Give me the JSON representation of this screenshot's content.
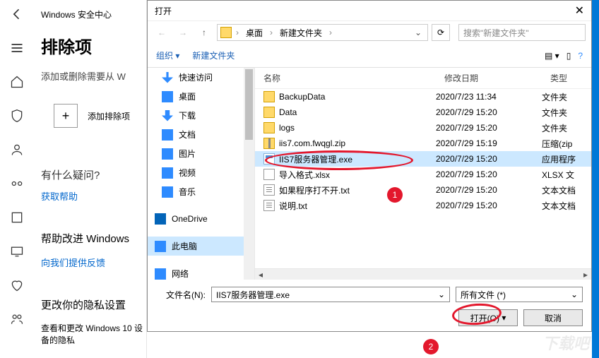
{
  "settings": {
    "window_title": "Windows 安全中心",
    "h1": "排除项",
    "sub": "添加或删除需要从 W",
    "add_label": "添加排除项",
    "question": "有什么疑问?",
    "help_link": "获取帮助",
    "improve": "帮助改进 Windows",
    "feedback_link": "向我们提供反馈",
    "privacy": "更改你的隐私设置",
    "privacy_sub": "查看和更改 Windows 10 设备的隐私"
  },
  "dialog": {
    "title": "打开",
    "close": "✕",
    "crumb_desktop": "桌面",
    "crumb_folder": "新建文件夹",
    "search_placeholder": "搜索\"新建文件夹\"",
    "organize": "组织",
    "newfolder": "新建文件夹",
    "col_name": "名称",
    "col_date": "修改日期",
    "col_type": "类型",
    "tree": [
      {
        "label": "快速访问",
        "icon": "pin"
      },
      {
        "label": "桌面",
        "icon": "desk"
      },
      {
        "label": "下载",
        "icon": "dl"
      },
      {
        "label": "文档",
        "icon": "doc"
      },
      {
        "label": "图片",
        "icon": "img"
      },
      {
        "label": "视频",
        "icon": "vid"
      },
      {
        "label": "音乐",
        "icon": "mus"
      },
      {
        "label": "OneDrive",
        "icon": "od"
      },
      {
        "label": "此电脑",
        "icon": "pc"
      },
      {
        "label": "网络",
        "icon": "net"
      }
    ],
    "files": [
      {
        "name": "BackupData",
        "date": "2020/7/23 11:34",
        "type": "文件夹",
        "icon": "folder"
      },
      {
        "name": "Data",
        "date": "2020/7/29 15:20",
        "type": "文件夹",
        "icon": "folder"
      },
      {
        "name": "logs",
        "date": "2020/7/29 15:20",
        "type": "文件夹",
        "icon": "folder"
      },
      {
        "name": "iis7.com.fwqgl.zip",
        "date": "2020/7/29 15:19",
        "type": "压缩(zip",
        "icon": "zip"
      },
      {
        "name": "IIS7服务器管理.exe",
        "date": "2020/7/29 15:20",
        "type": "应用程序",
        "icon": "exe",
        "sel": true
      },
      {
        "name": "导入格式.xlsx",
        "date": "2020/7/29 15:20",
        "type": "XLSX 文",
        "icon": "xlsx"
      },
      {
        "name": "如果程序打不开.txt",
        "date": "2020/7/29 15:20",
        "type": "文本文档",
        "icon": "txt"
      },
      {
        "name": "说明.txt",
        "date": "2020/7/29 15:20",
        "type": "文本文档",
        "icon": "txt"
      }
    ],
    "filename_label": "文件名(N):",
    "filename_value": "IIS7服务器管理.exe",
    "filter_value": "所有文件 (*)",
    "open_btn": "打开(O)",
    "cancel_btn": "取消"
  },
  "annotations": {
    "dot1": "1",
    "dot2": "2"
  }
}
